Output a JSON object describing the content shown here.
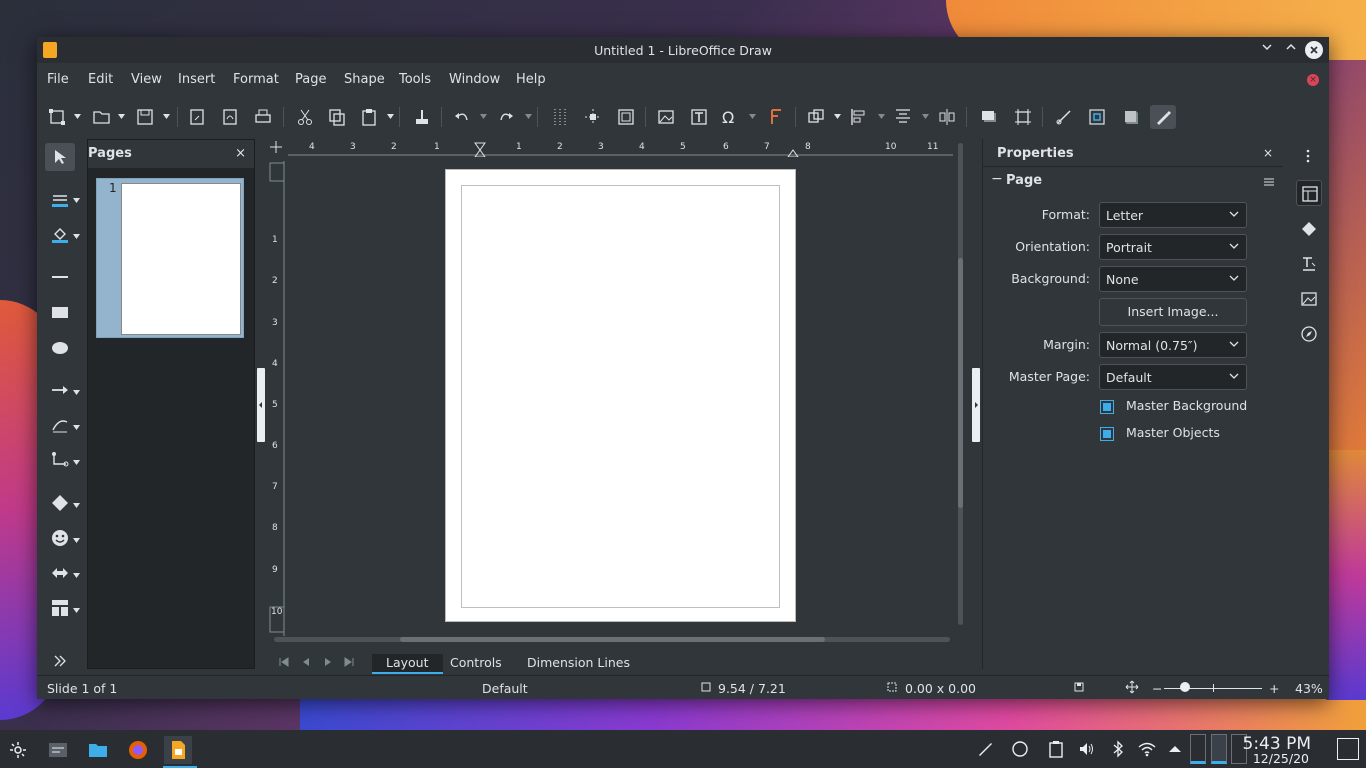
{
  "window": {
    "title": "Untitled 1 - LibreOffice Draw"
  },
  "menubar": {
    "items": [
      "File",
      "Edit",
      "View",
      "Insert",
      "Format",
      "Page",
      "Shape",
      "Tools",
      "Window",
      "Help"
    ]
  },
  "pages_panel": {
    "title": "Pages",
    "close": "×",
    "thumbnail_number": "1"
  },
  "ruler": {
    "h_ticks": [
      "4",
      "3",
      "2",
      "1",
      "1",
      "2",
      "3",
      "4",
      "5",
      "6",
      "7",
      "8",
      "10",
      "11"
    ],
    "v_ticks": [
      "1",
      "2",
      "3",
      "4",
      "5",
      "6",
      "7",
      "8",
      "9",
      "10"
    ]
  },
  "tabs": [
    "Layout",
    "Controls",
    "Dimension Lines"
  ],
  "properties": {
    "title": "Properties",
    "close": "×",
    "section": "Page",
    "collapse_glyph": "−",
    "format_label": "Format:",
    "format_value": "Letter",
    "orientation_label": "Orientation:",
    "orientation_value": "Portrait",
    "background_label": "Background:",
    "background_value": "None",
    "insert_image": "Insert Image...",
    "margin_label": "Margin:",
    "margin_value": "Normal (0.75″)",
    "master_page_label": "Master Page:",
    "master_page_value": "Default",
    "master_background": "Master Background",
    "master_objects": "Master Objects"
  },
  "status": {
    "slide": "Slide 1 of 1",
    "layout": "Default",
    "position": "9.54 / 7.21",
    "size": "0.00 x 0.00",
    "zoom_minus": "−",
    "zoom_plus": "+",
    "zoom": "43%"
  },
  "taskbar": {
    "time": "5:43 PM",
    "date": "12/25/20"
  },
  "colors": {
    "accent": "#3daee9",
    "window_bg": "#31363b",
    "panel_dark": "#232629",
    "close_red": "#da4453",
    "app_orange": "#f5a623"
  }
}
